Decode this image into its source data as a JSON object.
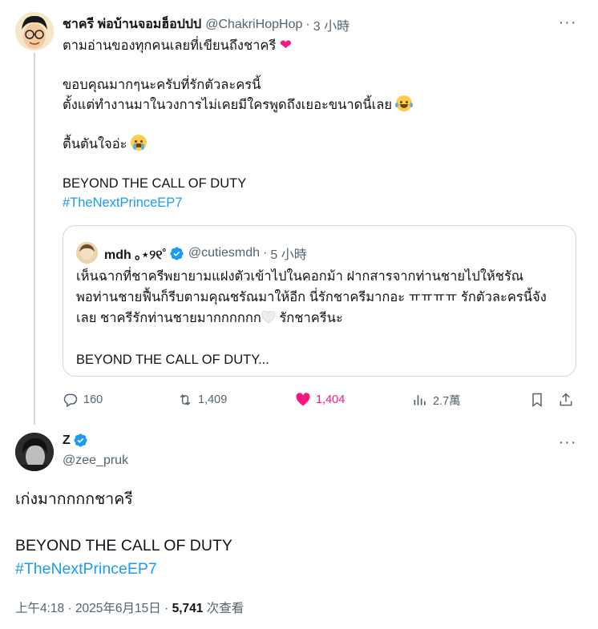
{
  "colors": {
    "accent": "#1d9bf0",
    "like": "#f91880",
    "muted": "#536471",
    "text": "#0f1419",
    "border": "#cfd9de"
  },
  "parent_tweet": {
    "author_name": "ชาครี พ่อบ้านจอมฮ็อปปป",
    "author_handle": "@ChakriHopHop",
    "separator": "·",
    "time": "3 小時",
    "lines": {
      "l1": "ตามอ่านของทุกคนเลยที่เขียนถึงชาครี",
      "l2": "",
      "l3": "ขอบคุณมากๆนะครับที่รักตัวละครนี้",
      "l4": "ตั้งแต่ทำงานมาในวงการไม่เคยมีใครพูดถึงเยอะขนาดนี้เลย",
      "l5": "",
      "l6": "ตื้นตันใจอ่ะ",
      "l7": "",
      "l8": "BEYOND THE CALL OF DUTY",
      "hashtag": "#TheNextPrinceEP7"
    },
    "emojis": [
      "red-heart",
      "tears-of-joy",
      "loudly-crying"
    ],
    "quoted": {
      "author_name": "mdh ｡⋆୨୧˚",
      "author_handle": "@cutiesmdh",
      "separator": "·",
      "time": "5 小時",
      "text_1": "เห็นฉากที่ชาครีพยายามแฝงตัวเข้าไปในคอกม้า ฝากสารจากท่านชายไปให้ชรัณ",
      "text_2": "พอท่านชายฟื้นก็รีบตามคุณชรัณมาให้อีก นี่รักชาครีมากอะ ㅠㅠㅠㅠ รักตัวละครนี้จัง",
      "text_3a": "เลย ชาครีรักท่านชายมากกกกกก",
      "text_3b": " รักชาครีนะ",
      "text_4": "",
      "text_5": "BEYOND THE CALL OF DUTY..."
    },
    "actions": {
      "replies": "160",
      "reposts": "1,409",
      "likes": "1,404",
      "views": "2.7萬"
    }
  },
  "main_tweet": {
    "author_name": "Z",
    "author_handle": "@zee_pruk",
    "line_1": "เก่งมากกกกชาครี",
    "line_2": "",
    "line_3": "BEYOND THE CALL OF DUTY",
    "hashtag": "#TheNextPrinceEP7",
    "timestamp": "上午4:18 · 2025年6月15日",
    "separator": "·",
    "views_count": "5,741",
    "views_label": "次查看"
  }
}
